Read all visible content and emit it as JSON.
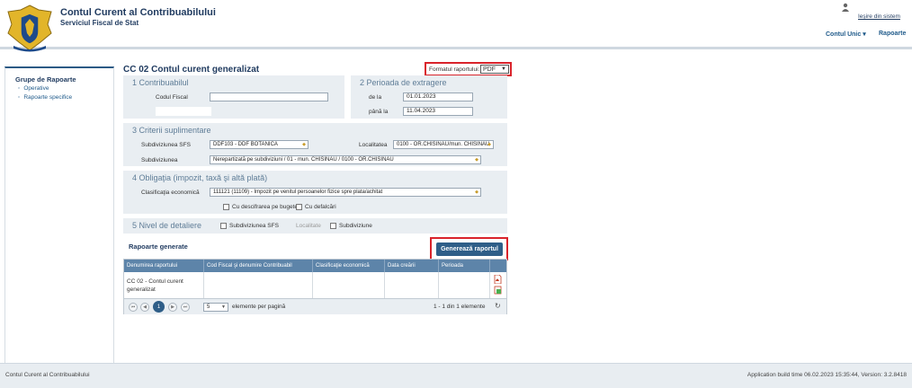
{
  "header": {
    "app_title": "Contul Curent al Contribuabilului",
    "app_subtitle": "Serviciul Fiscal de Stat",
    "logout": "Ieşire din sistem",
    "nav": [
      {
        "label": "Contul Unic ▾"
      },
      {
        "label": "Rapoarte"
      }
    ]
  },
  "sidebar": {
    "title": "Grupe de Rapoarte",
    "items": [
      {
        "label": "Operative"
      },
      {
        "label": "Rapoarte specifice"
      }
    ]
  },
  "main": {
    "title": "CC 02 Contul curent generalizat",
    "format_label": "Formatul raportului:",
    "format_value": "PDF",
    "section1": {
      "title": "1 Contribuabilul",
      "fiscal_code_label": "Codul Fiscal",
      "fiscal_code_value": ""
    },
    "section2": {
      "title": "2 Perioada de extragere",
      "from_label": "de la",
      "from_value": "01.01.2023",
      "to_label": "până la",
      "to_value": "11.04.2023"
    },
    "section3": {
      "title": "3 Criterii suplimentare",
      "sfs_label": "Subdiviziunea SFS",
      "sfs_value": "DDF103 - DDF BOTANICA",
      "locality_label": "Localitatea",
      "locality_value": "0100 - OR.CHISINAU/mun. CHISINAU",
      "subdiv_label": "Subdiviziunea",
      "subdiv_value": "Nerepartizată pe subdiviziuni / 01 - mun. CHISINAU / 0100 - OR.CHISINAU"
    },
    "section4": {
      "title": "4 Obligaţia (impozit, taxă şi altă plată)",
      "class_label": "Clasificaţia economică",
      "class_value": "111121 (11109) - Impozit pe venitul persoanelor fizice spre plata/achitat",
      "budget_check_label": "Cu descifrarea pe bugete",
      "discount_label": "Cu defalcări"
    },
    "section5": {
      "title": "5 Nivel de detaliere",
      "opt1": "Subdiviziunea SFS",
      "opt2": "Localitate",
      "opt3": "Subdiviziune"
    },
    "generate_button": "Generează raportul",
    "reports_title": "Rapoarte generate",
    "table": {
      "columns": [
        "Denumirea raportului",
        "Cod Fiscal şi denumire Contribuabil",
        "Clasificaţie economică",
        "Data creării",
        "Perioada"
      ],
      "rows": [
        {
          "name": "CC 02 - Contul curent generalizat",
          "fiscal": "",
          "class": "",
          "date": "",
          "period": ""
        }
      ]
    },
    "pager": {
      "current_page": "1",
      "page_size": "5",
      "per_page_label": "elemente per pagină",
      "summary": "1 - 1 din 1 elemente"
    }
  },
  "footer": {
    "left": "Contul Curent al Contribuabilului",
    "right": "Application build time 06.02.2023 15:35:44, Version: 3.2.8418"
  },
  "colors": {
    "brand": "#1f3a5f",
    "accent": "#2f5e88",
    "highlight": "#d9232b",
    "panel": "#e9eef2"
  }
}
